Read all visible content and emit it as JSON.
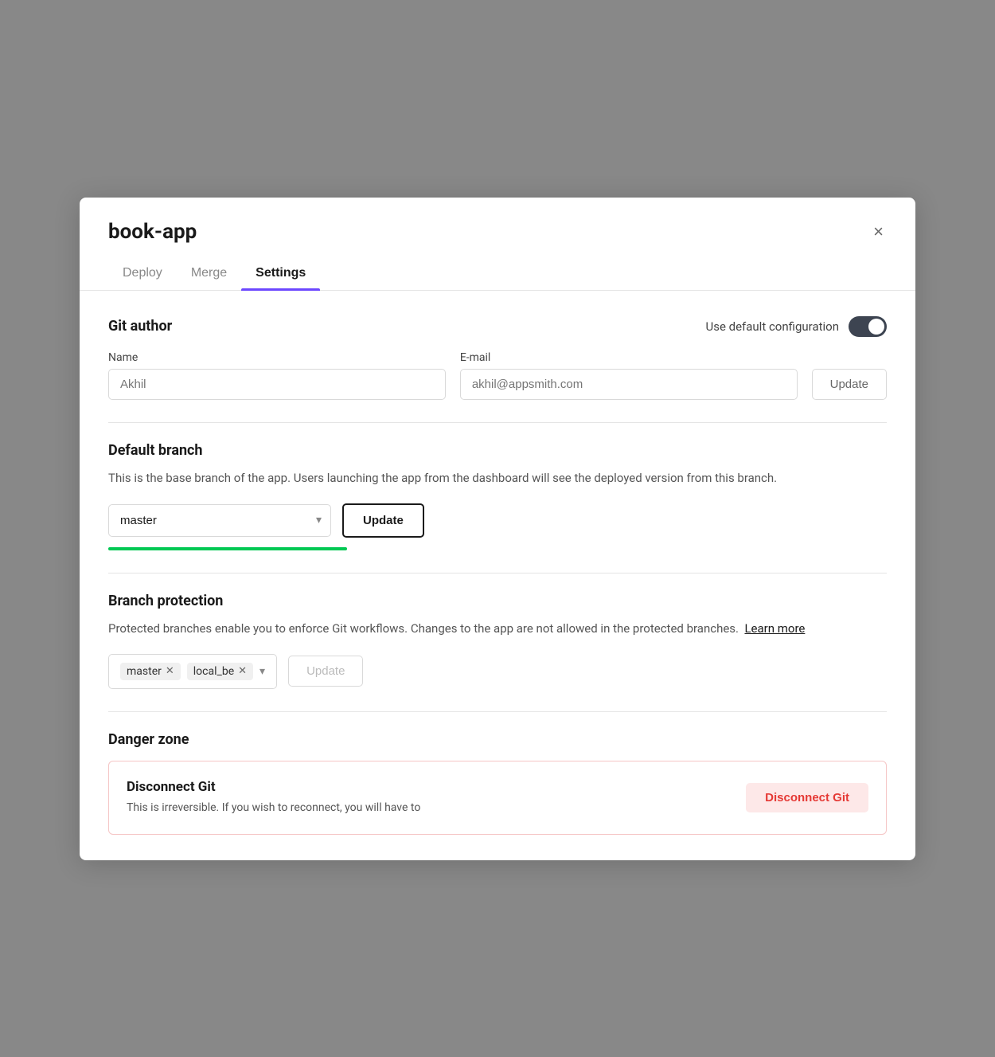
{
  "modal": {
    "title": "book-app",
    "close_label": "×"
  },
  "tabs": [
    {
      "id": "deploy",
      "label": "Deploy",
      "active": false
    },
    {
      "id": "merge",
      "label": "Merge",
      "active": false
    },
    {
      "id": "settings",
      "label": "Settings",
      "active": true
    }
  ],
  "git_author": {
    "section_title": "Git author",
    "use_default_label": "Use default configuration",
    "name_label": "Name",
    "name_placeholder": "Akhil",
    "email_label": "E-mail",
    "email_placeholder": "akhil@appsmith.com",
    "update_label": "Update"
  },
  "default_branch": {
    "section_title": "Default branch",
    "description": "This is the base branch of the app. Users launching the app from the dashboard will see the deployed version from this branch.",
    "branch_value": "master",
    "update_label": "Update"
  },
  "branch_protection": {
    "section_title": "Branch protection",
    "description": "Protected branches enable you to enforce Git workflows. Changes to the app are not allowed in the protected branches.",
    "learn_more_label": "Learn more",
    "tags": [
      {
        "id": "master",
        "label": "master"
      },
      {
        "id": "local_be",
        "label": "local_be"
      }
    ],
    "update_label": "Update"
  },
  "danger_zone": {
    "section_title": "Danger zone",
    "disconnect_git": {
      "title": "Disconnect Git",
      "description": "This is irreversible. If you wish to reconnect, you will have to",
      "button_label": "Disconnect Git"
    }
  }
}
